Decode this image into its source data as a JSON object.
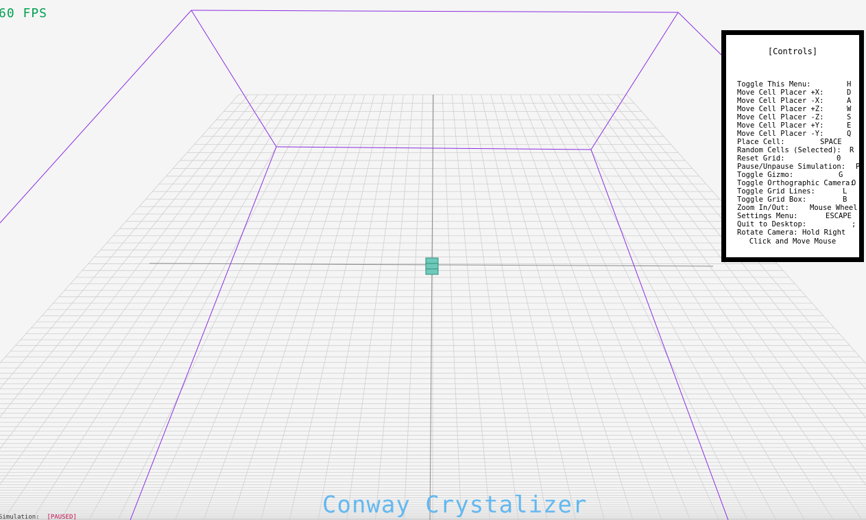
{
  "hud": {
    "fps": "60 FPS",
    "simulation_label": "Simulation:",
    "simulation_state": "[PAUSED]"
  },
  "title": "Conway Crystalizer",
  "controls": {
    "title": "[Controls]",
    "items": [
      {
        "action": "Toggle This Menu:",
        "key": "H"
      },
      {
        "action": "Move Cell Placer +X:",
        "key": "D"
      },
      {
        "action": "Move Cell Placer -X:",
        "key": "A"
      },
      {
        "action": "Move Cell Placer +Z:",
        "key": "W"
      },
      {
        "action": "Move Cell Placer -Z:",
        "key": "S"
      },
      {
        "action": "Move Cell Placer +Y:",
        "key": "E"
      },
      {
        "action": "Move Cell Placer -Y:",
        "key": "Q"
      },
      {
        "action": "Place Cell:",
        "key": "SPACE"
      },
      {
        "action": "Random Cells (Selected):",
        "key": "R"
      },
      {
        "action": "Reset Grid:",
        "key": "0"
      },
      {
        "action": "Pause/Unpause Simulation:",
        "key": "P"
      },
      {
        "action": "Toggle Gizmo:",
        "key": "G"
      },
      {
        "action": "Toggle Orthographic Camera:",
        "key": "O"
      },
      {
        "action": "Toggle Grid Lines:",
        "key": "L"
      },
      {
        "action": "Toggle Grid Box:",
        "key": "B"
      },
      {
        "action": "Zoom In/Out:",
        "key": "Mouse Wheel"
      },
      {
        "action": "Settings Menu:",
        "key": "ESCAPE"
      },
      {
        "action": "Quit to Desktop:",
        "key": ";"
      },
      {
        "action": "Rotate Camera:",
        "key": "Hold Right"
      }
    ],
    "footer": "Click and Move Mouse"
  },
  "colors": {
    "background": "#f5f5f5",
    "grid": "#cfcfcf",
    "axis": "#8a8a8a",
    "bounding_box": "#8a2be2",
    "cell_fill": "#6ec9b8",
    "cell_edge": "#2f8f7f",
    "fps": "#00a050",
    "title": "#63b8f0",
    "paused": "#c01050"
  },
  "icons": {
    "cell_placer": "cube-cursor-icon"
  }
}
